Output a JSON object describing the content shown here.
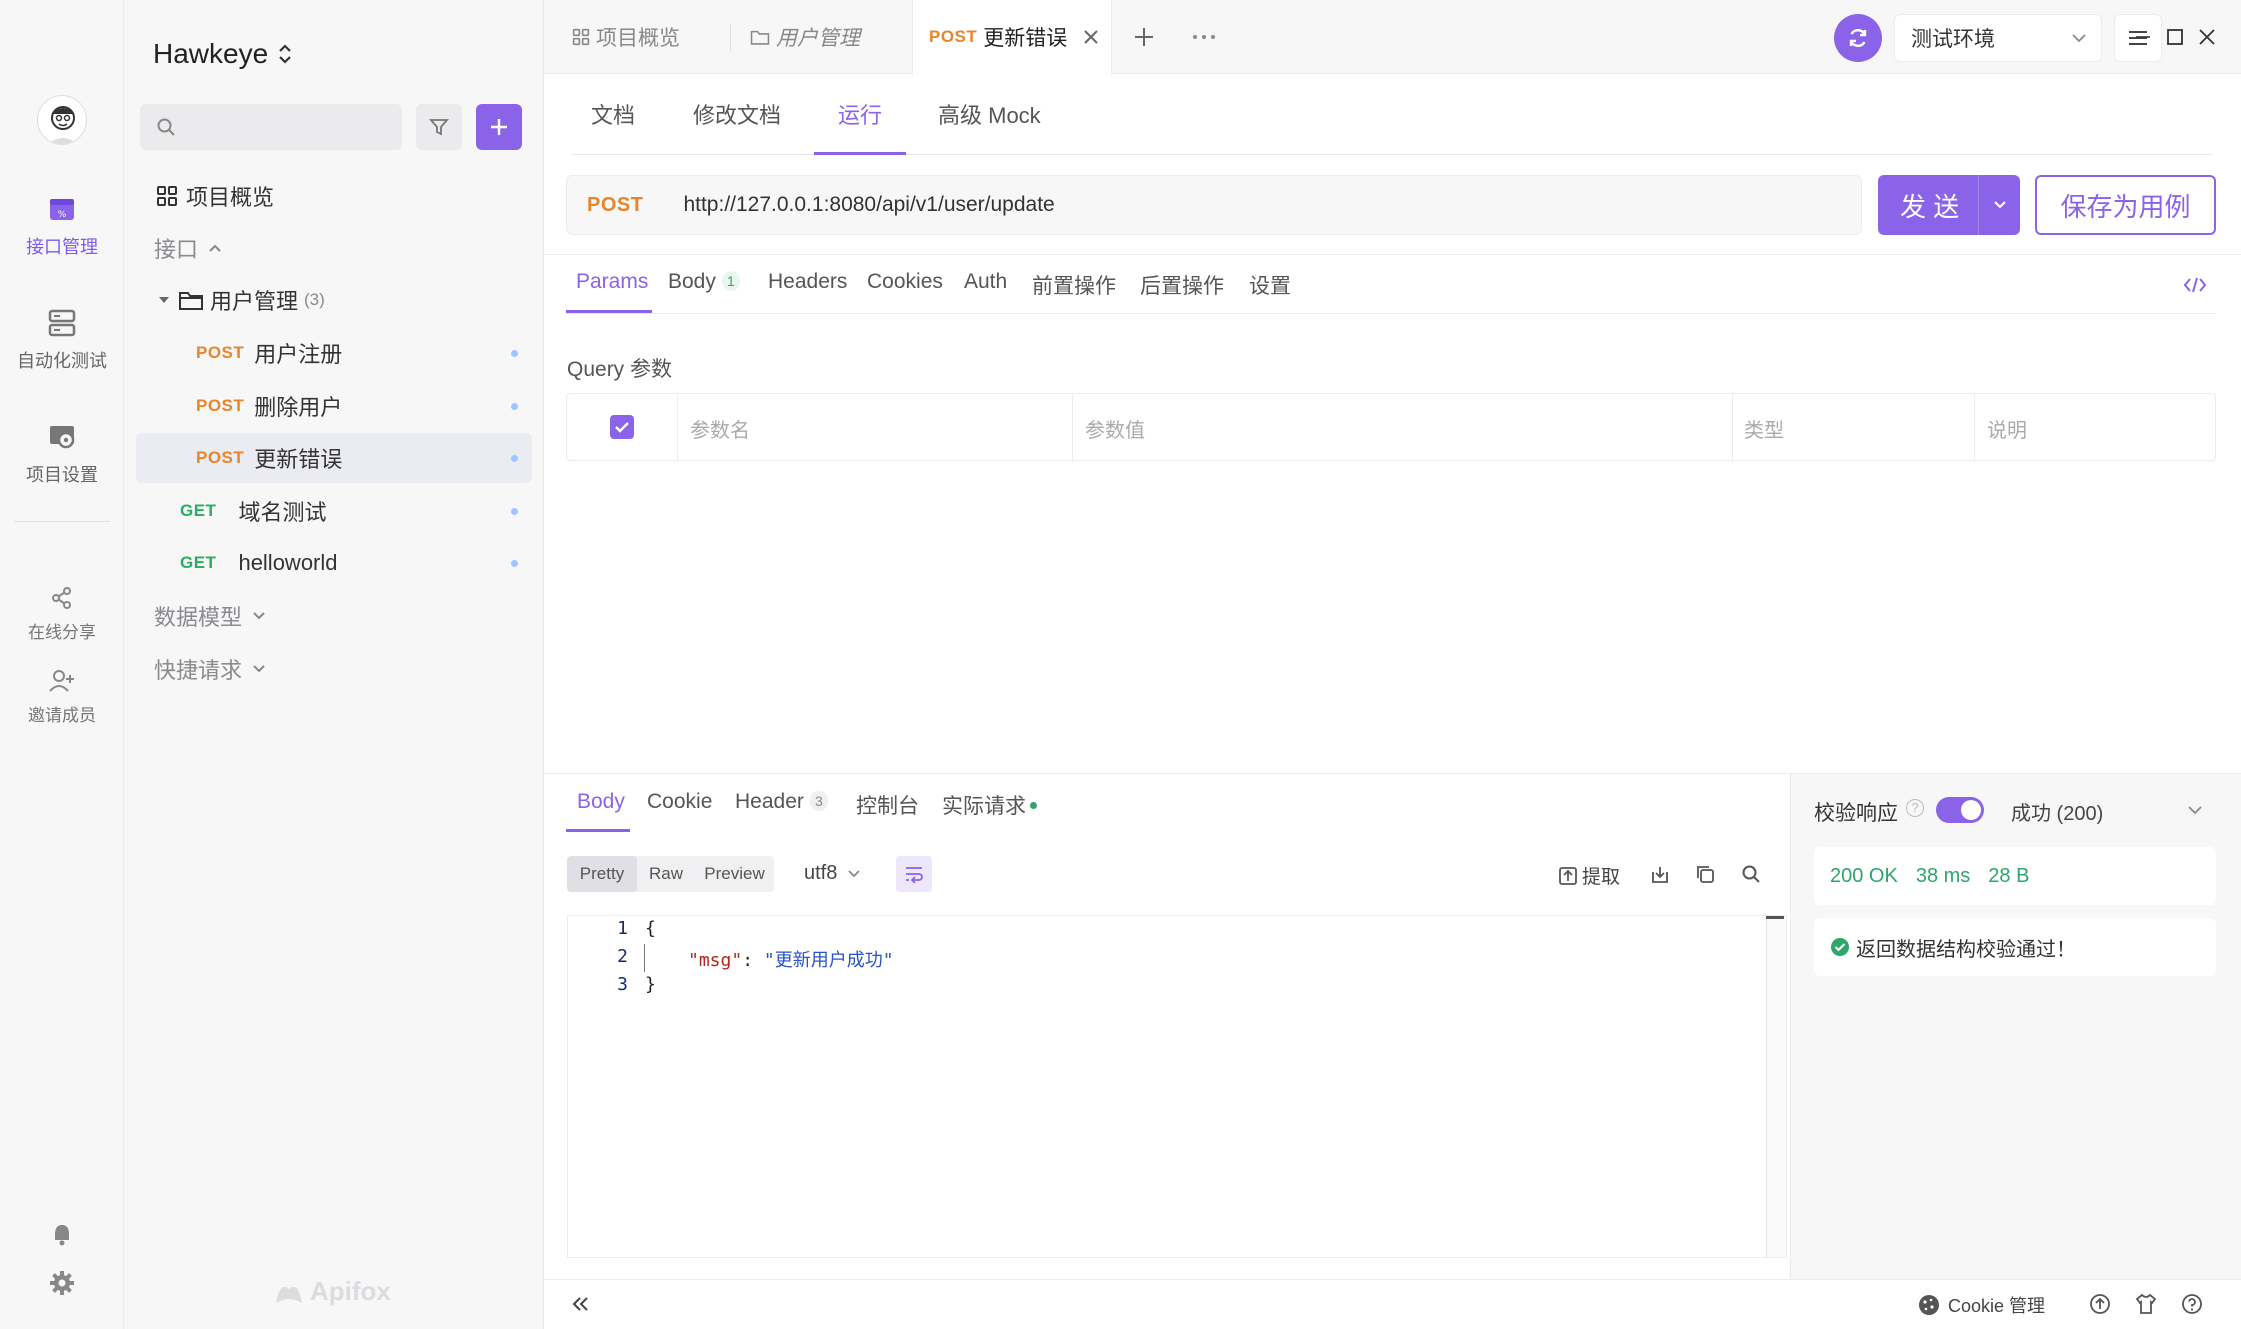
{
  "project": {
    "name": "Hawkeye"
  },
  "rail": {
    "items": [
      {
        "label": "接口管理",
        "icon": "api-icon"
      },
      {
        "label": "自动化测试",
        "icon": "automation-icon"
      },
      {
        "label": "项目设置",
        "icon": "settings-project-icon"
      },
      {
        "label": "在线分享",
        "icon": "share-icon"
      },
      {
        "label": "邀请成员",
        "icon": "invite-icon"
      }
    ]
  },
  "sidebar": {
    "search_placeholder": "",
    "overview_label": "项目概览",
    "api_section": "接口",
    "folder": {
      "name": "用户管理",
      "count": "(3)"
    },
    "endpoints": [
      {
        "method": "POST",
        "name": "用户注册"
      },
      {
        "method": "POST",
        "name": "删除用户"
      },
      {
        "method": "POST",
        "name": "更新错误"
      }
    ],
    "root_endpoints": [
      {
        "method": "GET",
        "name": "域名测试"
      },
      {
        "method": "GET",
        "name": "helloworld"
      }
    ],
    "data_model": "数据模型",
    "quick_request": "快捷请求",
    "brand": "Apifox"
  },
  "tabs": {
    "items": [
      {
        "label": "项目概览"
      },
      {
        "label": "用户管理"
      },
      {
        "method": "POST",
        "label": "更新错误"
      }
    ]
  },
  "env": {
    "selected": "测试环境"
  },
  "subtabs": [
    "文档",
    "修改文档",
    "运行",
    "高级 Mock"
  ],
  "request": {
    "method": "POST",
    "url": "http://127.0.0.1:8080/api/v1/user/update",
    "send_label": "发 送",
    "save_label": "保存为用例"
  },
  "req_tabs": {
    "params": "Params",
    "body": "Body",
    "body_count": "1",
    "headers": "Headers",
    "cookies": "Cookies",
    "auth": "Auth",
    "pre": "前置操作",
    "post": "后置操作",
    "settings": "设置"
  },
  "query": {
    "title": "Query 参数",
    "columns": {
      "name": "参数名",
      "value": "参数值",
      "type": "类型",
      "desc": "说明"
    }
  },
  "resp_tabs": {
    "body": "Body",
    "cookie": "Cookie",
    "header": "Header",
    "header_count": "3",
    "console": "控制台",
    "actual": "实际请求"
  },
  "view": {
    "pretty": "Pretty",
    "raw": "Raw",
    "preview": "Preview",
    "encoding": "utf8",
    "extract": "提取"
  },
  "code": {
    "lines": [
      {
        "n": "1",
        "open": "{"
      },
      {
        "n": "2",
        "key": "\"msg\"",
        "sep": ": ",
        "val": "\"更新用户成功\""
      },
      {
        "n": "3",
        "close": "}"
      }
    ]
  },
  "validation": {
    "label": "校验响应",
    "status": "成功 (200)",
    "code": "200 OK",
    "time": "38 ms",
    "size": "28 B",
    "message": "返回数据结构校验通过！"
  },
  "footer": {
    "cookie_mgmt": "Cookie 管理"
  },
  "colors": {
    "accent": "#8a63e8",
    "post": "#e8852a",
    "get": "#27ae60",
    "ok": "#2ea56a"
  }
}
